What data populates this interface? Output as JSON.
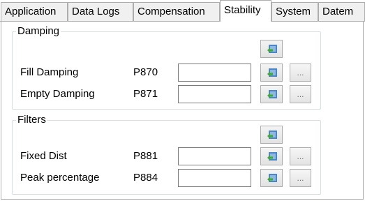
{
  "tabs": [
    "Application",
    "Data Logs",
    "Compensation",
    "Stability",
    "System",
    "Datem"
  ],
  "active_tab": "Stability",
  "groups": [
    {
      "title": "Damping",
      "rows": [
        {
          "label": "Fill Damping",
          "param": "P870",
          "value": "",
          "more_label": "..."
        },
        {
          "label": "Empty Damping",
          "param": "P871",
          "value": "",
          "more_label": "..."
        }
      ]
    },
    {
      "title": "Filters",
      "rows": [
        {
          "label": "Fixed Dist",
          "param": "P881",
          "value": "",
          "more_label": "..."
        },
        {
          "label": "Peak percentage",
          "param": "P884",
          "value": "",
          "more_label": "..."
        }
      ]
    }
  ],
  "icons": {
    "read_all": "download-arrow-icon",
    "read_param": "download-arrow-icon"
  },
  "colors": {
    "icon_blue": "#4a86c8",
    "icon_green": "#3daa3d",
    "border": "#adadad",
    "group_border": "#d5dfe5"
  }
}
